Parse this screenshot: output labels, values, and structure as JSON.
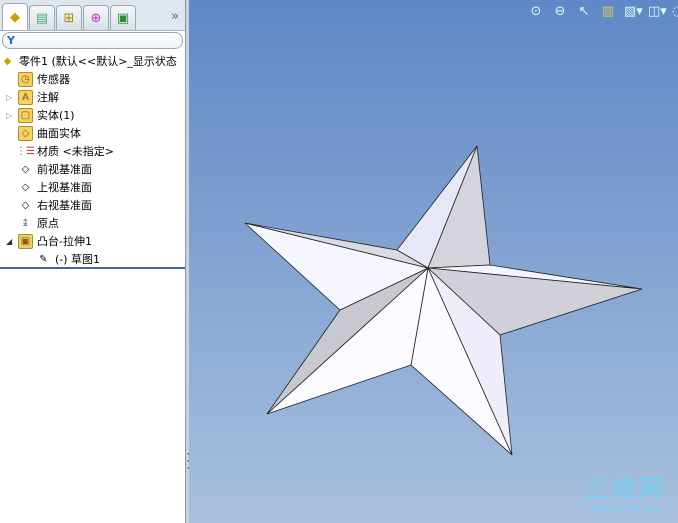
{
  "tabs": [
    {
      "name": "featuremanager",
      "icon": "part-icon"
    },
    {
      "name": "propertymanager",
      "icon": "property-icon"
    },
    {
      "name": "configurationmanager",
      "icon": "config-icon"
    },
    {
      "name": "dimxpert",
      "icon": "target-icon"
    },
    {
      "name": "display",
      "icon": "display-icon"
    }
  ],
  "more": "»",
  "filter_icon": "Y",
  "tree": {
    "root": "零件1 (默认<<默认>_显示状态",
    "items": [
      "传感器",
      "注解",
      "实体(1)",
      "曲面实体",
      "材质 <未指定>",
      "前视基准面",
      "上视基准面",
      "右视基准面",
      "原点",
      "凸台-拉伸1",
      "(-) 草图1"
    ]
  },
  "watermark": {
    "title": "三维网",
    "url": "3dportal.cn"
  },
  "colors": {
    "viewport_top": "#5f88c6",
    "viewport_bottom": "#a8c0de"
  }
}
